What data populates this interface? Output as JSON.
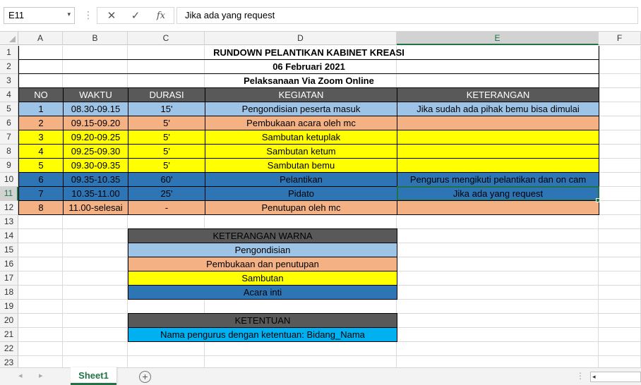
{
  "formula_bar": {
    "name_box": "E11",
    "name_box_arrow": "▾",
    "separator": "⋮",
    "cancel_glyph": "✕",
    "enter_glyph": "✓",
    "fx_label": "fx",
    "formula": "Jika ada yang request"
  },
  "columns": [
    "A",
    "B",
    "C",
    "D",
    "E",
    "F"
  ],
  "rows": [
    "1",
    "2",
    "3",
    "4",
    "5",
    "6",
    "7",
    "8",
    "9",
    "10",
    "11",
    "12",
    "13",
    "14",
    "15",
    "16",
    "17",
    "18",
    "19",
    "20",
    "21",
    "22",
    "23"
  ],
  "selected": {
    "column": "E",
    "row": "11"
  },
  "title_block": {
    "title": "RUNDOWN PELANTIKAN KABINET KREASI",
    "date": "06 Februari 2021",
    "venue": "Pelaksanaan Via Zoom Online"
  },
  "table": {
    "headers": [
      "NO",
      "WAKTU",
      "DURASI",
      "KEGIATAN",
      "KETERANGAN"
    ],
    "rows": [
      {
        "no": "1",
        "waktu": "08.30-09.15",
        "durasi": "15'",
        "kegiatan": "Pengondisian peserta masuk",
        "keterangan": "Jika sudah ada pihak bemu bisa dimulai",
        "fill": "#9dc3e6"
      },
      {
        "no": "2",
        "waktu": "09.15-09.20",
        "durasi": "5'",
        "kegiatan": "Pembukaan acara oleh mc",
        "keterangan": "",
        "fill": "#f4b183"
      },
      {
        "no": "3",
        "waktu": "09.20-09.25",
        "durasi": "5'",
        "kegiatan": "Sambutan ketuplak",
        "keterangan": "",
        "fill": "#ffff00"
      },
      {
        "no": "4",
        "waktu": "09.25-09.30",
        "durasi": "5'",
        "kegiatan": "Sambutan ketum",
        "keterangan": "",
        "fill": "#ffff00"
      },
      {
        "no": "5",
        "waktu": "09.30-09.35",
        "durasi": "5'",
        "kegiatan": "Sambutan bemu",
        "keterangan": "",
        "fill": "#ffff00"
      },
      {
        "no": "6",
        "waktu": "09.35-10.35",
        "durasi": "60'",
        "kegiatan": "Pelantikan",
        "keterangan": "Pengurus mengikuti pelantikan dan on cam",
        "fill": "#2e75b6"
      },
      {
        "no": "7",
        "waktu": "10.35-11.00",
        "durasi": "25'",
        "kegiatan": "Pidato",
        "keterangan": "Jika ada yang request",
        "fill": "#2e75b6"
      },
      {
        "no": "8",
        "waktu": "11.00-selesai",
        "durasi": "-",
        "kegiatan": "Penutupan oleh mc",
        "keterangan": "",
        "fill": "#f4b183"
      }
    ]
  },
  "legend": {
    "header": "KETERANGAN WARNA",
    "items": [
      {
        "label": "Pengondisian",
        "fill": "#9dc3e6"
      },
      {
        "label": "Pembukaan dan penutupan",
        "fill": "#f4b183"
      },
      {
        "label": "Sambutan",
        "fill": "#ffff00"
      },
      {
        "label": "Acara inti",
        "fill": "#2e75b6"
      }
    ]
  },
  "rules": {
    "header": "KETENTUAN",
    "text": "Nama pengurus dengan ketentuan: Bidang_Nama",
    "fill": "#00b0f0"
  },
  "colors": {
    "header_fill": "#595959",
    "header_text": "#ffffff",
    "accent": "#217346"
  },
  "tabs": {
    "prev_glyph": "◂",
    "next_glyph": "▸",
    "sheet_name": "Sheet1",
    "add_glyph": "+",
    "more_glyph": "⋮",
    "scroll_left_glyph": "◂"
  }
}
